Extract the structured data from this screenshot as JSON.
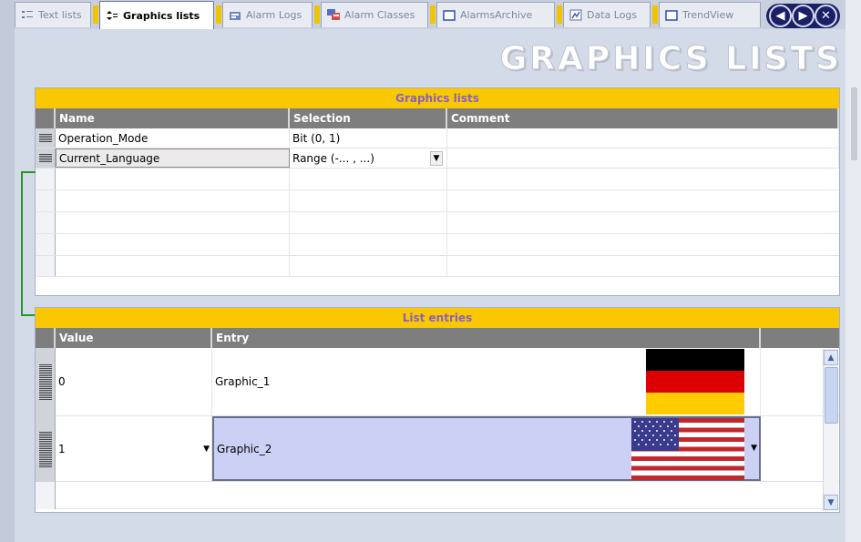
{
  "tabs": [
    {
      "label": "Text lists",
      "icon": "list-icon",
      "active": false
    },
    {
      "label": "Graphics lists",
      "icon": "graphics-list-icon",
      "active": true
    },
    {
      "label": "Alarm Logs",
      "icon": "alarm-log-icon",
      "active": false
    },
    {
      "label": "Alarm Classes",
      "icon": "alarm-classes-icon",
      "active": false
    },
    {
      "label": "AlarmsArchive",
      "icon": "window-icon",
      "active": false
    },
    {
      "label": "Data Logs",
      "icon": "data-log-icon",
      "active": false
    },
    {
      "label": "TrendView",
      "icon": "window-icon",
      "active": false
    }
  ],
  "nav": {
    "prev": "◀",
    "next": "▶",
    "close": "✕"
  },
  "page_title": "GRAPHICS LISTS",
  "graphics_lists": {
    "title": "Graphics lists",
    "columns": [
      "Name",
      "Selection",
      "Comment"
    ],
    "rows": [
      {
        "name": "Operation_Mode",
        "selection": "Bit (0, 1)",
        "comment": ""
      },
      {
        "name": "Current_Language",
        "selection": "Range (-... , ...)",
        "comment": ""
      }
    ]
  },
  "list_entries": {
    "title": "List entries",
    "columns": [
      "Value",
      "Entry"
    ],
    "rows": [
      {
        "value": "0",
        "entry": "Graphic_1",
        "flag": "germany-flag"
      },
      {
        "value": "1",
        "entry": "Graphic_2",
        "flag": "usa-flag"
      }
    ]
  },
  "colors": {
    "accent_yellow": "#f9c800",
    "header_text": "#8a5fc8",
    "column_header": "#7e7e7e",
    "selected_row": "#ccd0f4",
    "bracket": "#229922"
  }
}
